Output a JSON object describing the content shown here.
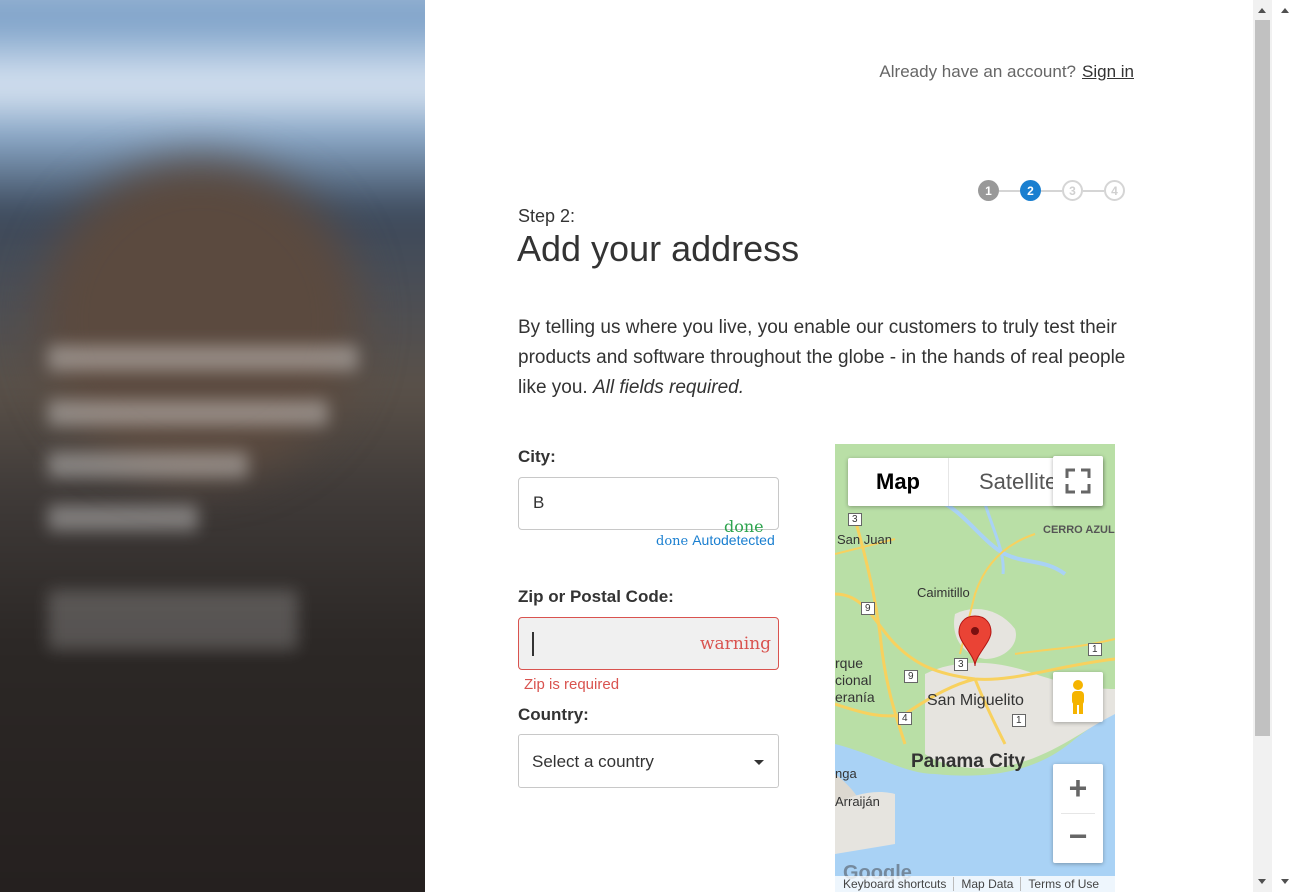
{
  "header": {
    "prompt": "Already have an account?",
    "signin_label": "Sign in"
  },
  "stepper": {
    "steps": [
      "1",
      "2",
      "3",
      "4"
    ],
    "current": 2
  },
  "form": {
    "step_label": "Step 2:",
    "title": "Add your address",
    "intro": "By telling us where you live, you enable our customers to truly test their products and software throughout the globe - in the hands of real people like you.",
    "intro_emphasis": "All fields required.",
    "city": {
      "label": "City:",
      "value": "B",
      "icon_text": "done",
      "note_icon": "done",
      "note": "Autodetected"
    },
    "zip": {
      "label": "Zip or Postal Code:",
      "value": "",
      "icon_text": "warning",
      "error": "Zip is required"
    },
    "country": {
      "label": "Country:",
      "selected": "Select a country"
    }
  },
  "map": {
    "tabs": [
      "Map",
      "Satellite"
    ],
    "active_tab": "Map",
    "labels": [
      "Panama City",
      "San Miguelito",
      "Caimitillo",
      "San Juan",
      "CERRO AZUL",
      "rque",
      "cional",
      "eranía",
      "nga",
      "Arraiján"
    ],
    "road_numbers": [
      "3",
      "9",
      "3",
      "9",
      "4",
      "1",
      "1"
    ],
    "footer": [
      "Keyboard shortcuts",
      "Map Data",
      "Terms of Use"
    ],
    "zoom_in": "+",
    "zoom_out": "−",
    "logo": "Google",
    "colors": {
      "land": "#b9dfa6",
      "water": "#a9d2f5",
      "urban": "#e6e4df",
      "road": "#f8d15e",
      "pin": "#ea4335"
    }
  }
}
